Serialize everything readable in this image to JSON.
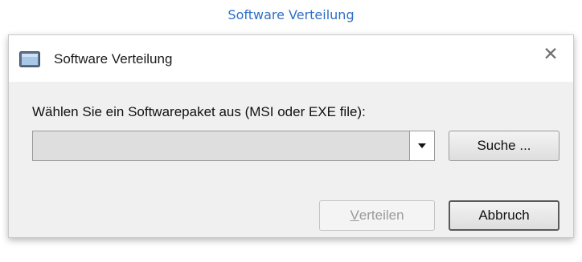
{
  "caption": "Software Verteilung",
  "window": {
    "title": "Software Verteilung",
    "icon": "window-app-icon",
    "close_glyph": "✕"
  },
  "form": {
    "prompt": "Wählen Sie ein Softwarepaket aus (MSI oder EXE file):",
    "package_value": "",
    "package_dropdown_icon": "triangle-down-icon"
  },
  "buttons": {
    "search_label": "Suche ...",
    "distribute_mnemonic": "V",
    "distribute_rest": "erteilen",
    "distribute_enabled": false,
    "cancel_label": "Abbruch"
  }
}
